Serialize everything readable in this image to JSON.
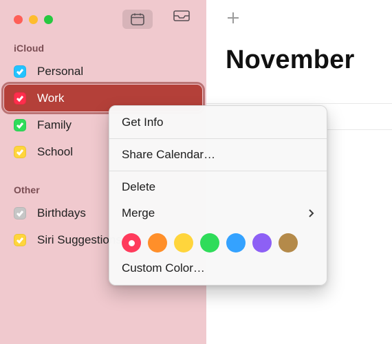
{
  "sidebar": {
    "section1_title": "iCloud",
    "section2_title": "Other",
    "items1": [
      {
        "label": "Personal",
        "color": "#23c3ff",
        "checked": true,
        "selected": false
      },
      {
        "label": "Work",
        "color": "#ff2e4c",
        "checked": true,
        "selected": true
      },
      {
        "label": "Family",
        "color": "#2fdc5a",
        "checked": true,
        "selected": false
      },
      {
        "label": "School",
        "color": "#ffd53c",
        "checked": true,
        "selected": false
      }
    ],
    "items2": [
      {
        "label": "Birthdays",
        "color": "#c6c6c6",
        "checked": true,
        "selected": false
      },
      {
        "label": "Siri Suggestions",
        "color": "#ffd53c",
        "checked": true,
        "selected": false
      }
    ]
  },
  "main": {
    "month_title": "November"
  },
  "context_menu": {
    "get_info": "Get Info",
    "share": "Share Calendar…",
    "delete": "Delete",
    "merge": "Merge",
    "custom": "Custom Color…",
    "swatches": [
      {
        "color": "#ff3b5c",
        "selected": true
      },
      {
        "color": "#ff8f2a",
        "selected": false
      },
      {
        "color": "#ffd53c",
        "selected": false
      },
      {
        "color": "#2fdc5a",
        "selected": false
      },
      {
        "color": "#34a2ff",
        "selected": false
      },
      {
        "color": "#8d60f5",
        "selected": false
      },
      {
        "color": "#b48a4a",
        "selected": false
      }
    ]
  }
}
